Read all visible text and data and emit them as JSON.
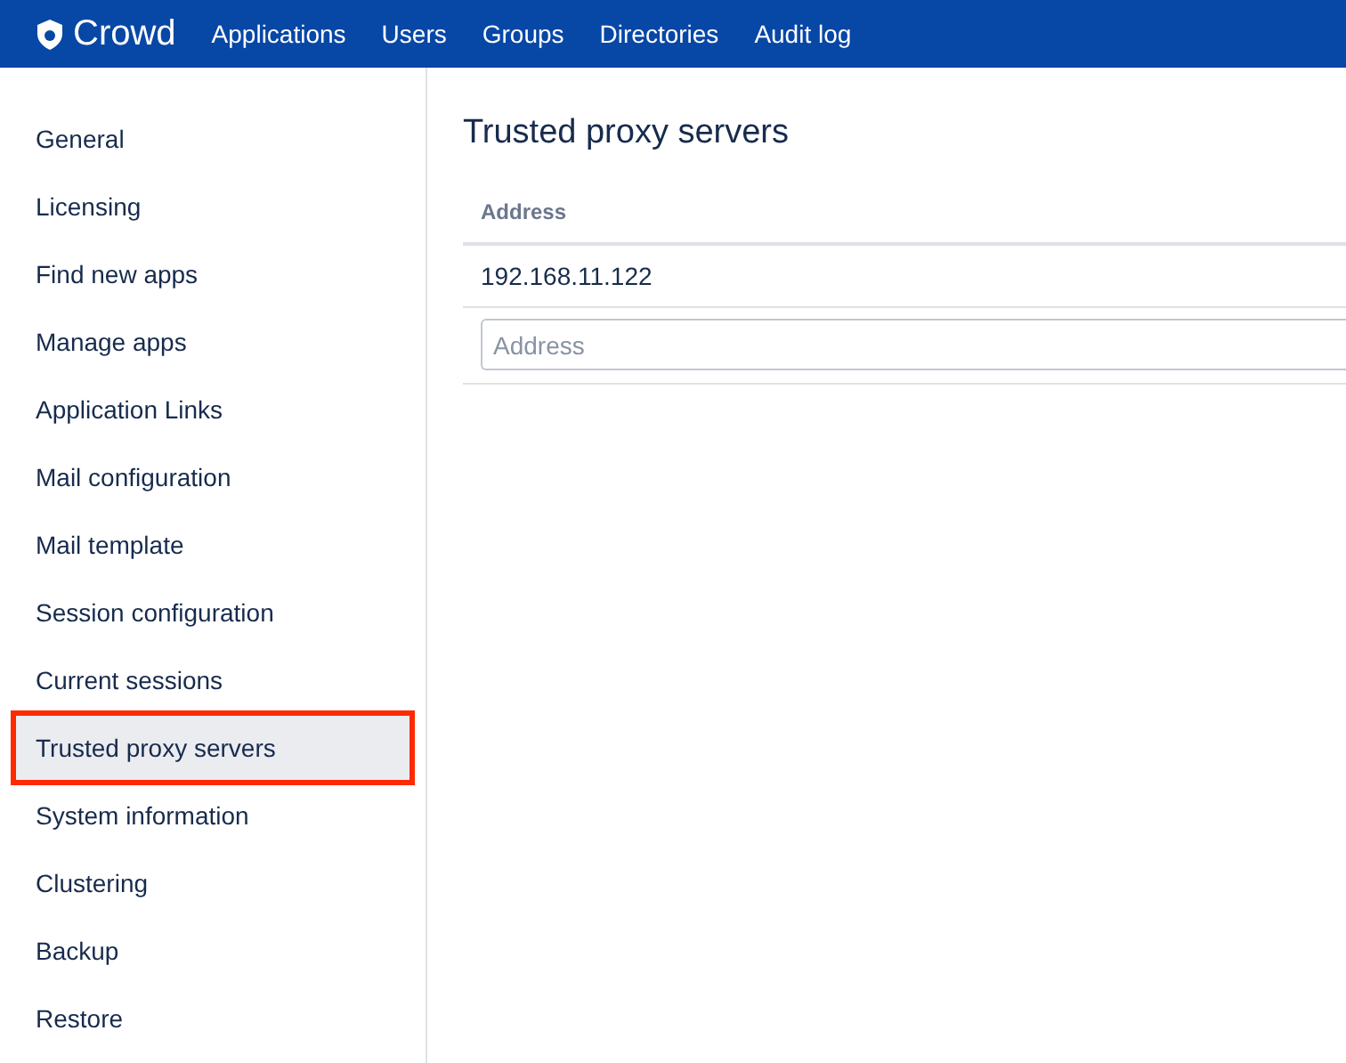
{
  "header": {
    "logo": "Crowd",
    "nav": [
      {
        "label": "Applications"
      },
      {
        "label": "Users"
      },
      {
        "label": "Groups"
      },
      {
        "label": "Directories"
      },
      {
        "label": "Audit log"
      }
    ]
  },
  "sidebar": {
    "items": [
      {
        "label": "General",
        "selected": false
      },
      {
        "label": "Licensing",
        "selected": false
      },
      {
        "label": "Find new apps",
        "selected": false
      },
      {
        "label": "Manage apps",
        "selected": false
      },
      {
        "label": "Application Links",
        "selected": false
      },
      {
        "label": "Mail configuration",
        "selected": false
      },
      {
        "label": "Mail template",
        "selected": false
      },
      {
        "label": "Session configuration",
        "selected": false
      },
      {
        "label": "Current sessions",
        "selected": false
      },
      {
        "label": "Trusted proxy servers",
        "selected": true
      },
      {
        "label": "System information",
        "selected": false
      },
      {
        "label": "Clustering",
        "selected": false
      },
      {
        "label": "Backup",
        "selected": false
      },
      {
        "label": "Restore",
        "selected": false
      }
    ]
  },
  "main": {
    "title": "Trusted proxy servers",
    "table": {
      "columns": [
        "Address"
      ],
      "rows": [
        [
          "192.168.11.122"
        ]
      ],
      "new_row": {
        "placeholder": "Address"
      }
    }
  }
}
